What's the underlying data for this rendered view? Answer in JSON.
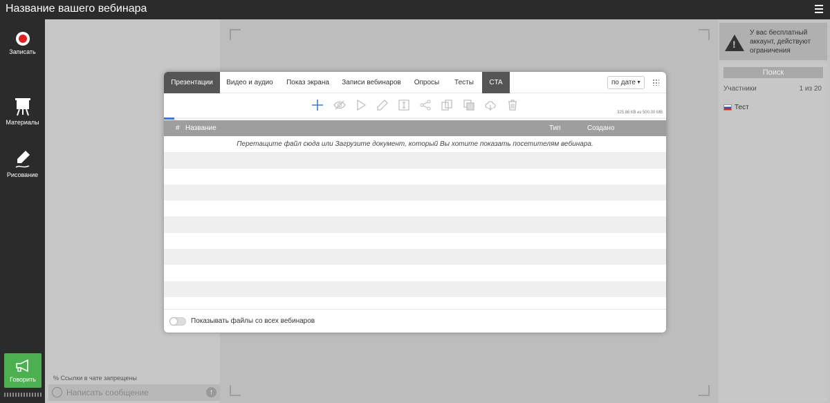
{
  "header": {
    "title": "Название вашего вебинара",
    "menu_icon": "hamburger-icon"
  },
  "leftnav": {
    "record_label": "Записать",
    "materials_label": "Материалы",
    "drawing_label": "Рисование",
    "speak_label": "Говорить"
  },
  "chat": {
    "links_notice": "Ссылки в чате запрещены",
    "input_placeholder": "Написать сообщение"
  },
  "right": {
    "warning_text": "У вас бесплатный аккаунт, действуют ограничения",
    "search_label": "Поиск",
    "participants_label": "Участники",
    "participants_count": "1 из 20",
    "participants": [
      {
        "name": "Тест"
      }
    ]
  },
  "modal": {
    "tabs": [
      {
        "label": "Презентации"
      },
      {
        "label": "Видео и аудио"
      },
      {
        "label": "Показ экрана"
      },
      {
        "label": "Записи вебинаров"
      },
      {
        "label": "Опросы"
      },
      {
        "label": "Тесты"
      },
      {
        "label": "CTA"
      }
    ],
    "sort_value": "по дате",
    "storage_text": "325.86 КВ из 500.00 МВ",
    "storage_fraction": 0.02,
    "columns": {
      "num": "#",
      "name": "Название",
      "type": "Тип",
      "created": "Создано"
    },
    "empty_message": "Перетащите файл сюда или Загрузите документ, который Вы хотите показать посетителям вебинара.",
    "show_all_label": "Показывать файлы со всех вебинаров",
    "show_all_checked": false,
    "accent_color": "#3b7dc8"
  }
}
